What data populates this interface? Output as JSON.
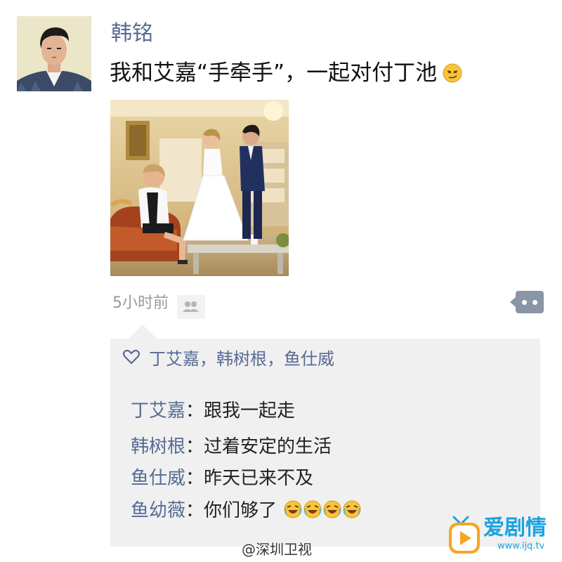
{
  "post": {
    "author": "韩铭",
    "text": "我和艾嘉“手牵手”，一起对付丁池",
    "text_emoji": "smirk-emoji",
    "time": "5小时前"
  },
  "likes": {
    "names": "丁艾嘉，韩树根，鱼仕威"
  },
  "comments": [
    {
      "name": "丁艾嘉",
      "sep": "：",
      "text": "跟我一起走"
    },
    {
      "name": "韩树根",
      "sep": "：",
      "text": "过着安定的生活"
    },
    {
      "name": "鱼仕威",
      "sep": "：",
      "text": "昨天已来不及"
    },
    {
      "name": "鱼幼薇",
      "sep": "：",
      "text": "你们够了",
      "emoji": "laughing-crying-emoji x4"
    }
  ],
  "watermark": {
    "left": "@深圳卫视",
    "logo_name": "爱剧情",
    "logo_url": "www.ijq.tv"
  },
  "colors": {
    "name_link": "#576b95",
    "panel_bg": "#f0f0f0",
    "time_gray": "#9a9a9a",
    "logo_blue": "#1aa3e0",
    "logo_orange": "#f5a623"
  }
}
